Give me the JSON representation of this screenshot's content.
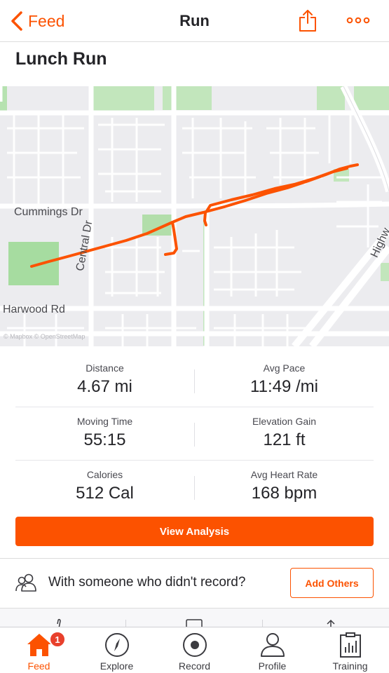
{
  "nav": {
    "back_label": "Feed",
    "title": "Run",
    "share_icon": "share-icon",
    "more_icon": "more-dots-icon"
  },
  "activity": {
    "title": "Lunch Run"
  },
  "map": {
    "street_labels": [
      "Cummings Dr",
      "Central Dr",
      "Harwood Rd",
      "Highw"
    ],
    "attribution": "© Mapbox © OpenStreetMap",
    "route_color": "#fc5200"
  },
  "stats": [
    {
      "label": "Distance",
      "value": "4.67 mi"
    },
    {
      "label": "Avg Pace",
      "value": "11:49 /mi"
    },
    {
      "label": "Moving Time",
      "value": "55:15"
    },
    {
      "label": "Elevation Gain",
      "value": "121 ft"
    },
    {
      "label": "Calories",
      "value": "512 Cal"
    },
    {
      "label": "Avg Heart Rate",
      "value": "168 bpm"
    }
  ],
  "analysis_button": "View Analysis",
  "others": {
    "text": "With someone who didn't record?",
    "button": "Add Others",
    "icon": "people-icon"
  },
  "tabbar": {
    "tabs": [
      {
        "label": "Feed",
        "icon": "home-icon",
        "active": true,
        "badge": "1"
      },
      {
        "label": "Explore",
        "icon": "compass-icon"
      },
      {
        "label": "Record",
        "icon": "record-icon"
      },
      {
        "label": "Profile",
        "icon": "person-icon"
      },
      {
        "label": "Training",
        "icon": "training-chart-icon"
      }
    ]
  },
  "colors": {
    "accent": "#fc5200",
    "badge": "#e8402c",
    "text": "#242428"
  }
}
